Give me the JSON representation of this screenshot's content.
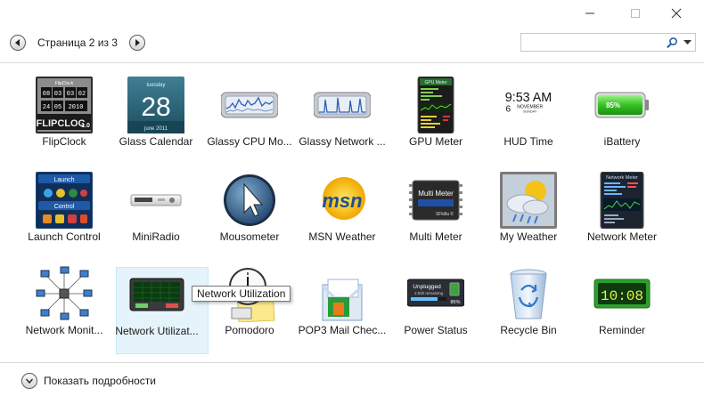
{
  "window": {
    "buttons": [
      "minimize",
      "maximize",
      "close"
    ]
  },
  "pager": {
    "text": "Страница 2 из 3"
  },
  "search": {
    "value": "",
    "placeholder": ""
  },
  "gadgets": [
    {
      "label": "FlipClock",
      "icon": "flipclock-icon",
      "thumb": {
        "line1": "FlipClock",
        "line2": "FLIPCLOC",
        "line3": "1.0",
        "digits": [
          "08",
          "03",
          "03",
          "02",
          "24",
          "05",
          "2010"
        ]
      }
    },
    {
      "label": "Glass Calendar",
      "icon": "glass-calendar-icon",
      "thumb": {
        "day": "tuesday",
        "date": "28",
        "month": "june 2011"
      }
    },
    {
      "label": "Glassy CPU Mo...",
      "icon": "glassy-cpu-monitor-icon"
    },
    {
      "label": "Glassy Network ...",
      "icon": "glassy-network-monitor-icon"
    },
    {
      "label": "GPU Meter",
      "icon": "gpu-meter-icon",
      "thumb": {
        "title": "GPU Meter"
      }
    },
    {
      "label": "HUD Time",
      "icon": "hud-time-icon",
      "thumb": {
        "time": "9:53 AM",
        "day": "6",
        "month": "NOVEMBER",
        "weekday": "SUNDAY"
      }
    },
    {
      "label": "iBattery",
      "icon": "battery-icon",
      "thumb": {
        "level": "85%"
      }
    },
    {
      "label": "Launch Control",
      "icon": "launch-control-icon",
      "thumb": {
        "top": "Launch",
        "bottom": "Control"
      }
    },
    {
      "label": "MiniRadio",
      "icon": "radio-icon"
    },
    {
      "label": "Mousometer",
      "icon": "mousometer-icon"
    },
    {
      "label": "MSN Weather",
      "icon": "msn-weather-icon",
      "thumb": {
        "text": "msn"
      }
    },
    {
      "label": "Multi Meter",
      "icon": "multi-meter-icon",
      "thumb": {
        "line1": "Multi Meter",
        "line2": "SFkilla ©"
      }
    },
    {
      "label": "My Weather",
      "icon": "my-weather-icon"
    },
    {
      "label": "Network Meter",
      "icon": "network-meter-icon",
      "thumb": {
        "title": "Network Meter"
      }
    },
    {
      "label": "Network Monit...",
      "icon": "network-monitor-icon"
    },
    {
      "label": "Network Utilizat...",
      "icon": "network-utilization-icon",
      "selected": true
    },
    {
      "label": "Pomodoro",
      "icon": "pomodoro-icon"
    },
    {
      "label": "POP3 Mail Chec...",
      "icon": "pop3-mail-checker-icon"
    },
    {
      "label": "Power Status",
      "icon": "power-status-icon",
      "thumb": {
        "line1": "Unplugged",
        "line2": "1:53h remaining",
        "level": "85%"
      }
    },
    {
      "label": "Recycle Bin",
      "icon": "recycle-bin-icon"
    },
    {
      "label": "Reminder",
      "icon": "reminder-icon",
      "thumb": {
        "time": "10:08"
      }
    }
  ],
  "tooltip": {
    "text": "Network Utilization"
  },
  "details": {
    "label": "Показать подробности"
  },
  "colors": {
    "selection_bg": "#e5f3fb",
    "selection_border": "#cce8f6",
    "separator": "#d9d9d9"
  }
}
